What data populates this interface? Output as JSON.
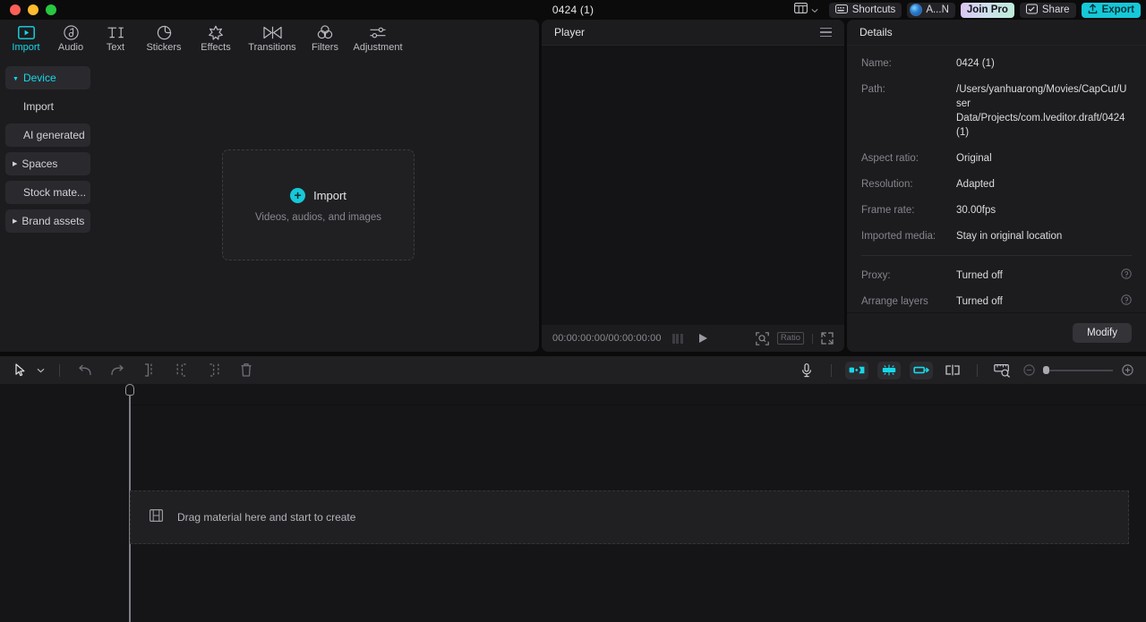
{
  "titlebar": {
    "project_title": "0424 (1)",
    "layout_icon": "layout-grid-icon",
    "chevron_icon": "chevron-down-icon",
    "shortcuts_label": "Shortcuts",
    "shortcuts_icon": "keyboard-icon",
    "user_label": "A...N",
    "pro_label": "Join Pro",
    "share_label": "Share",
    "share_icon": "share-box-icon",
    "export_label": "Export",
    "export_icon": "upload-icon"
  },
  "topnav": {
    "tabs": [
      {
        "label": "Import",
        "icon": "import-play-icon",
        "active": true
      },
      {
        "label": "Audio",
        "icon": "audio-note-icon",
        "active": false
      },
      {
        "label": "Text",
        "icon": "text-ti-icon",
        "active": false
      },
      {
        "label": "Stickers",
        "icon": "sticker-icon",
        "active": false
      },
      {
        "label": "Effects",
        "icon": "effects-star-icon",
        "active": false
      },
      {
        "label": "Transitions",
        "icon": "transitions-icon",
        "active": false
      },
      {
        "label": "Filters",
        "icon": "filters-circles-icon",
        "active": false
      },
      {
        "label": "Adjustment",
        "icon": "adjustment-sliders-icon",
        "active": false
      }
    ]
  },
  "sidebar": {
    "items": [
      {
        "label": "Device",
        "caret": "down",
        "active": true,
        "filled": true
      },
      {
        "label": "Import",
        "caret": "none",
        "active": false,
        "filled": false
      },
      {
        "label": "AI generated",
        "caret": "none",
        "active": false,
        "filled": true
      },
      {
        "label": "Spaces",
        "caret": "right",
        "active": false,
        "filled": true
      },
      {
        "label": "Stock mate...",
        "caret": "none",
        "active": false,
        "filled": true
      },
      {
        "label": "Brand assets",
        "caret": "right",
        "active": false,
        "filled": true
      }
    ]
  },
  "dropzone": {
    "icon": "plus-circle-icon",
    "title": "Import",
    "subtitle": "Videos, audios, and images"
  },
  "player": {
    "title": "Player",
    "menu_icon": "hamburger-icon",
    "current_time": "00:00:00:00",
    "separator": "/",
    "total_time": "00:00:00:00",
    "grid_icon": "keyframe-grid-icon",
    "play_icon": "play-icon",
    "zoom_icon": "zoom-fit-icon",
    "ratio_label": "Ratio",
    "fullscreen_icon": "fullscreen-icon"
  },
  "details": {
    "title": "Details",
    "rows": [
      {
        "key": "Name:",
        "value": "0424 (1)",
        "help": false
      },
      {
        "key": "Path:",
        "value": "/Users/yanhuarong/Movies/CapCut/User Data/Projects/com.lveditor.draft/0424 (1)",
        "help": false
      },
      {
        "key": "Aspect ratio:",
        "value": "Original",
        "help": false
      },
      {
        "key": "Resolution:",
        "value": "Adapted",
        "help": false
      },
      {
        "key": "Frame rate:",
        "value": "30.00fps",
        "help": false
      },
      {
        "key": "Imported media:",
        "value": "Stay in original location",
        "help": false
      }
    ],
    "rows_after_divider": [
      {
        "key": "Proxy:",
        "value": "Turned off",
        "help": true,
        "help_icon": "help-circle-icon"
      },
      {
        "key": "Arrange layers",
        "value": "Turned off",
        "help": true,
        "help_icon": "help-circle-icon"
      }
    ],
    "modify_label": "Modify"
  },
  "timeline_toolbar": {
    "left_icons": [
      "cursor-arrow-icon",
      "chevron-down-icon",
      "divider",
      "undo-icon",
      "redo-icon",
      "split-icon",
      "trim-left-icon",
      "trim-right-icon",
      "delete-icon"
    ],
    "right_icons": [
      "microphone-icon",
      "divider",
      "clip-insert-icon",
      "clip-multi-icon",
      "clip-replace-icon",
      "split-clip-icon",
      "divider",
      "ruler-zoom-icon",
      "zoom-out-icon",
      "zoom-slider",
      "zoom-in-icon"
    ],
    "zoom_level": 0
  },
  "timeline": {
    "playhead_position": "00:00:00:00",
    "drop_hint_icon": "film-strip-icon",
    "drop_hint_text": "Drag material here and start to create"
  },
  "colors": {
    "accent": "#16d8e8",
    "export_bg": "#16c8d8",
    "panel_bg": "#1c1c1f",
    "window_bg": "#0b0b0c",
    "timeline_bg": "#151517"
  }
}
